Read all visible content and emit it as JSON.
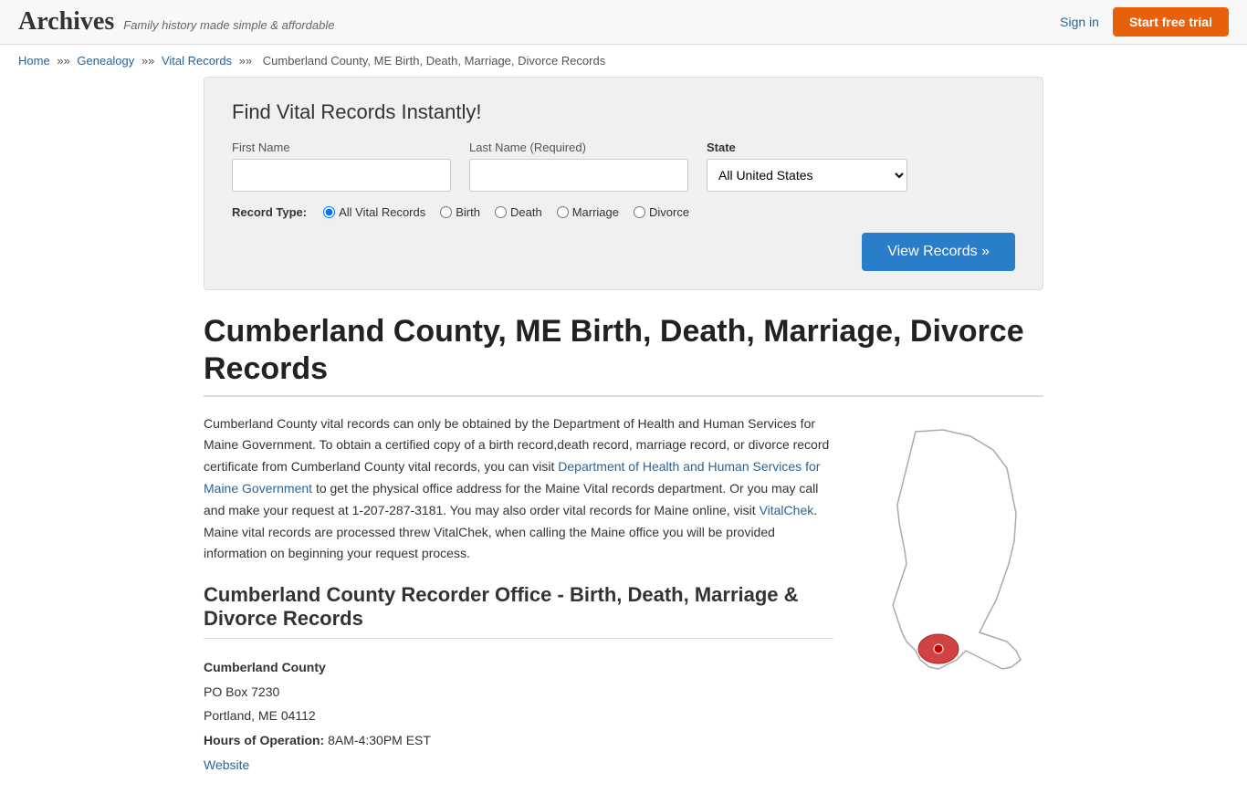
{
  "header": {
    "logo": "Archives",
    "tagline": "Family history made simple & affordable",
    "signin_label": "Sign in",
    "trial_label": "Start free trial"
  },
  "breadcrumb": {
    "home": "Home",
    "genealogy": "Genealogy",
    "vital_records": "Vital Records",
    "current": "Cumberland County, ME Birth, Death, Marriage, Divorce Records"
  },
  "search": {
    "title": "Find Vital Records Instantly!",
    "first_name_label": "First Name",
    "last_name_label": "Last Name",
    "last_name_required": "(Required)",
    "state_label": "State",
    "state_value": "All United States",
    "record_type_label": "Record Type:",
    "record_types": [
      "All Vital Records",
      "Birth",
      "Death",
      "Marriage",
      "Divorce"
    ],
    "view_records_label": "View Records »"
  },
  "page_title": "Cumberland County, ME Birth, Death, Marriage, Divorce Records",
  "body_text": "Cumberland County vital records can only be obtained by the Department of Health and Human Services for Maine Government. To obtain a certified copy of a birth record,death record, marriage record, or divorce record certificate from Cumberland County vital records, you can visit Department of Health and Human Services for Maine Government to get the physical office address for the Maine Vital records department. Or you may call and make your request at 1-207-287-3181. You may also order vital records for Maine online, visit VitalChek. Maine vital records are processed threw VitalChek, when calling the Maine office you will be provided information on beginning your request process.",
  "recorder_section_title": "Cumberland County Recorder Office - Birth, Death, Marriage & Divorce Records",
  "office": {
    "name": "Cumberland County",
    "address1": "PO Box 7230",
    "address2": "Portland, ME 04112",
    "hours_label": "Hours of Operation:",
    "hours": "8AM-4:30PM EST",
    "website_label": "Website"
  },
  "links": {
    "dept_health": "Department of Health and Human Services for Maine Government",
    "vitalchek": "VitalChek"
  }
}
